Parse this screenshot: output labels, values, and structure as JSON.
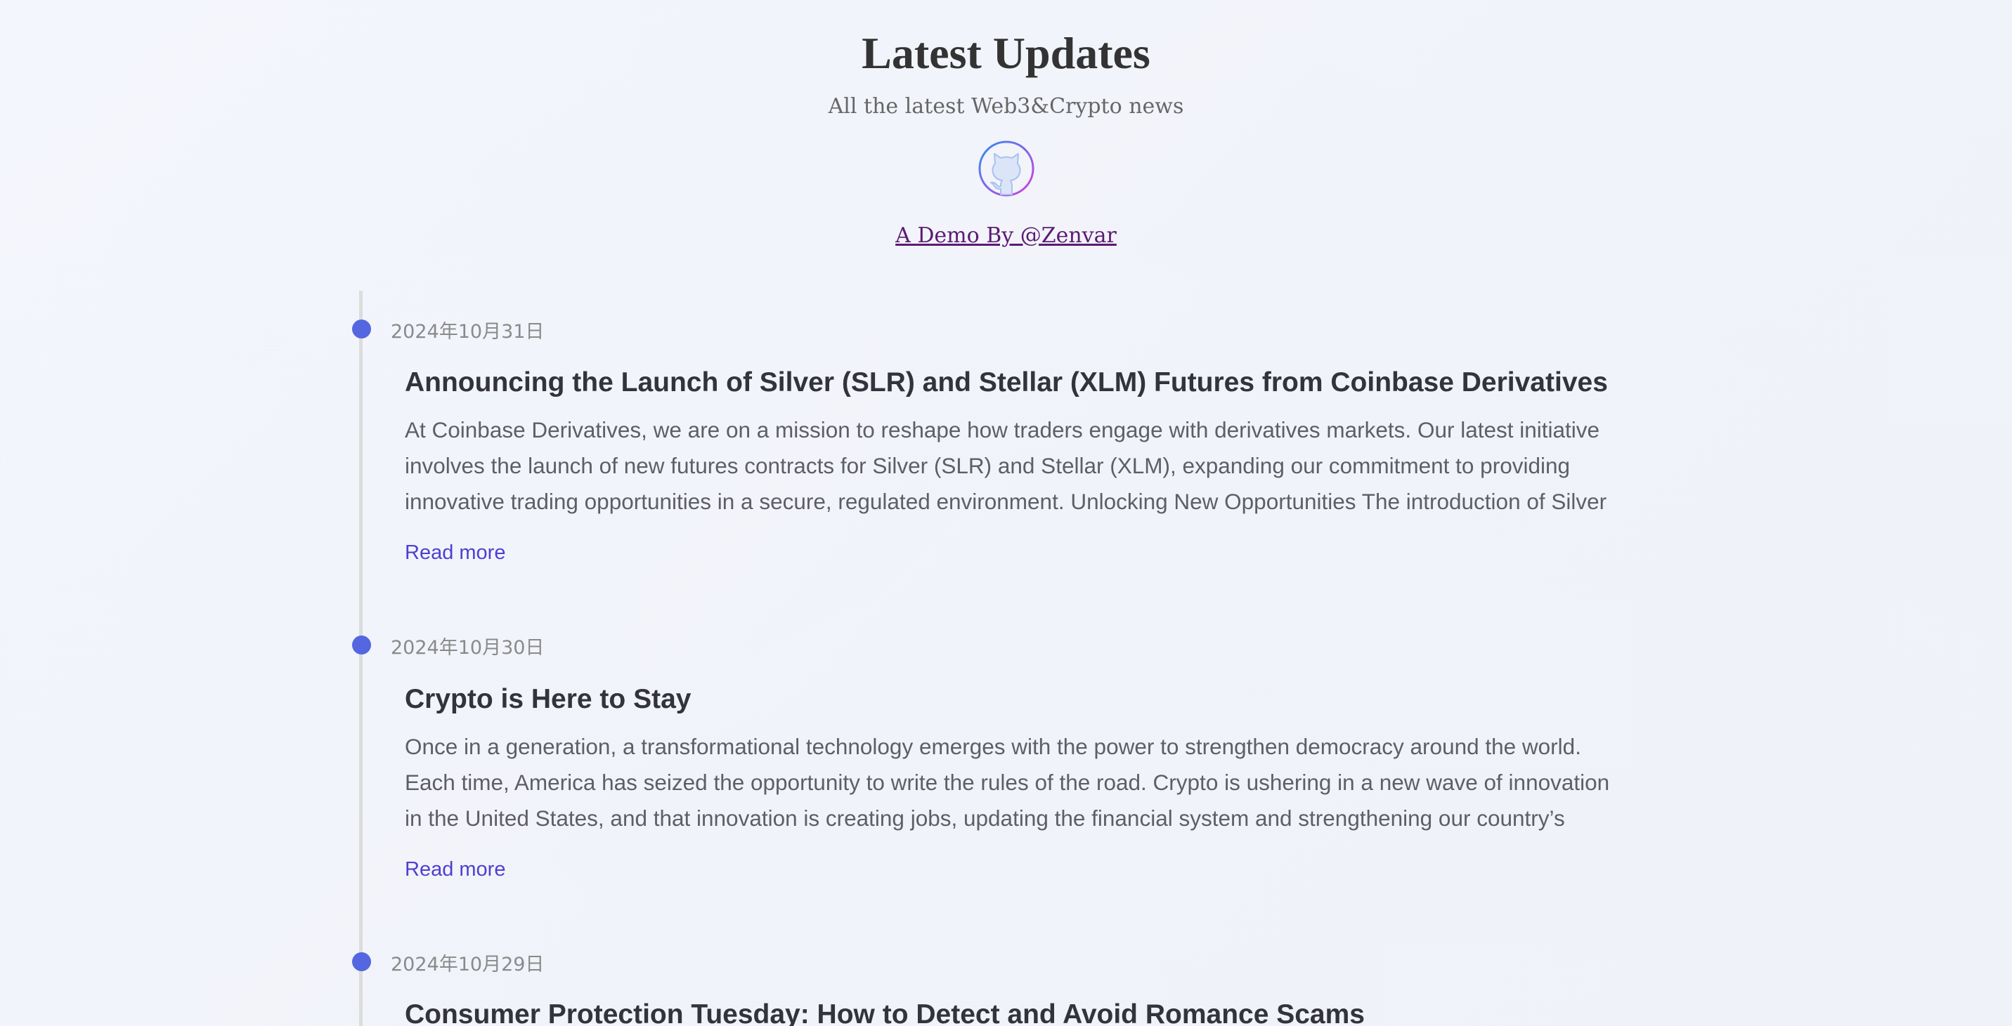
{
  "header": {
    "title": "Latest Updates",
    "subtitle": "All the latest Web3&Crypto news",
    "github_icon": "github-icon",
    "demo_link": "A Demo By @Zenvar"
  },
  "colors": {
    "accent_dot": "#5466e0",
    "link": "#4f3fd0",
    "demo_link": "#5b1a72",
    "github_ring_start": "#2f8df5",
    "github_ring_end": "#d43ee0"
  },
  "posts": [
    {
      "date": "2024年10月31日",
      "title": "Announcing the Launch of Silver (SLR) and Stellar (XLM) Futures from Coinbase Derivatives",
      "lines": [
        "At Coinbase Derivatives, we are on a mission to reshape how traders engage with derivatives markets. Our latest initiative",
        "involves the launch of new futures contracts for Silver (SLR) and Stellar (XLM), expanding our commitment to providing",
        "innovative trading opportunities in a secure, regulated environment. Unlocking New Opportunities The introduction of Silver"
      ],
      "read_more": "Read more"
    },
    {
      "date": "2024年10月30日",
      "title": "Crypto is Here to Stay",
      "lines": [
        "Once in a generation, a transformational technology emerges with the power to strengthen  democracy around the world.",
        "Each time, America has seized the opportunity to write the rules of the road. Crypto is ushering in a new wave of innovation",
        "in the United States, and that innovation is creating jobs, updating the financial system and strengthening our country’s"
      ],
      "read_more": "Read more"
    },
    {
      "date": "2024年10月29日",
      "title": "Consumer Protection Tuesday: How to Detect and Avoid Romance Scams"
    }
  ]
}
